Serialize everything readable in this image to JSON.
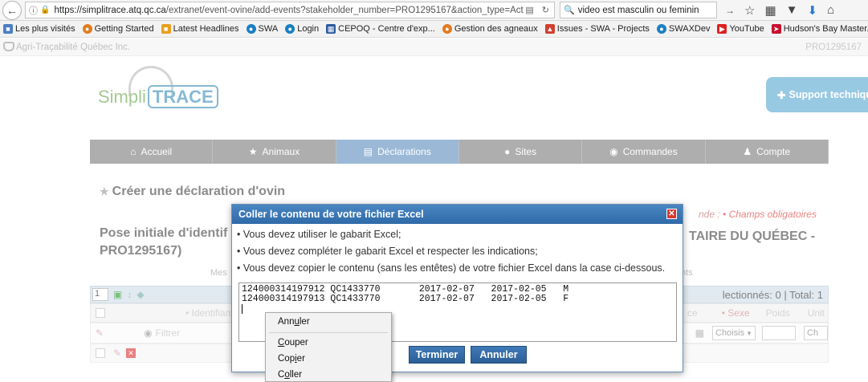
{
  "browser": {
    "url_host": "https://simplitrace.atq.qc.ca",
    "url_path": "/extranet/event-ovine/add-events?stakeholder_number=PRO1295167&action_type=Act",
    "search_text": "video est masculin ou feminin"
  },
  "bookmarks": [
    {
      "label": "Les plus visités",
      "icon": "page-icon",
      "color": "#4a7fc1"
    },
    {
      "label": "Getting Started",
      "icon": "firefox-icon",
      "color": "#e07b20"
    },
    {
      "label": "Latest Headlines",
      "icon": "rss-icon",
      "color": "#e8a020"
    },
    {
      "label": "SWA",
      "icon": "swa-icon",
      "color": "#1a7fc1"
    },
    {
      "label": "Login",
      "icon": "swa-icon",
      "color": "#1a7fc1"
    },
    {
      "label": "CEPOQ - Centre d'exp...",
      "icon": "table-icon",
      "color": "#2c5aa0"
    },
    {
      "label": "Gestion des agneaux",
      "icon": "firefox-icon",
      "color": "#e07b20"
    },
    {
      "label": "Issues - SWA - Projects",
      "icon": "jira-icon",
      "color": "#d04030"
    },
    {
      "label": "SWAXDev",
      "icon": "swa-icon",
      "color": "#1a7fc1"
    },
    {
      "label": "YouTube",
      "icon": "youtube-icon",
      "color": "#e02020"
    },
    {
      "label": "Hudson's Bay Master...",
      "icon": "hudson-icon",
      "color": "#c8102e"
    }
  ],
  "site": {
    "org": "Agri-Traçabilité Québec Inc.",
    "stakeholder": "PRO1295167",
    "brand_simpli": "Simpli",
    "brand_trace": "TRACE",
    "support": "Support technique",
    "menu": [
      "Accueil",
      "Animaux",
      "Déclarations",
      "Sites",
      "Commandes",
      "Compte"
    ],
    "heading": "Créer une déclaration d'ovin",
    "legend_label": "nde :",
    "legend_required": "• Champs obligatoires",
    "pose_title": "Pose initiale d'identif PRO1295167)",
    "right_title": "TAIRE DU QUÉBEC -",
    "faint_left": "Mes",
    "faint_right": "nts",
    "page_num": "1",
    "selection": "lectionnés: 0 | Total: 1",
    "col_identifiants": "• Identifiants",
    "col_sexe": "• Sexe",
    "col_poids": "Poids",
    "col_unit": "Unit",
    "col_ce": "ce",
    "filter_placeholder": "Filtrer",
    "select_choisis": "Choisis",
    "select_ch": "Ch"
  },
  "modal": {
    "title": "Coller le contenu de votre fichier Excel",
    "instructions": [
      "• Vous devez utiliser le gabarit Excel;",
      "• Vous devez compléter le gabarit Excel et respecter les indications;",
      "• Vous devez copier le contenu (sans les entêtes) de votre fichier Excel dans la case ci-dessous."
    ],
    "paste_lines": [
      "124000314197912 QC1433770       2017-02-07   2017-02-05   M",
      "124000314197913 QC1433770       2017-02-07   2017-02-05   F"
    ],
    "btn_terminer": "Terminer",
    "btn_annuler": "Annuler"
  },
  "context_menu": {
    "undo_pre": "Ann",
    "undo_key": "u",
    "undo_post": "ler",
    "cut_key": "C",
    "cut_post": "ouper",
    "copy_pre": "Cop",
    "copy_key": "i",
    "copy_post": "er",
    "paste_pre": "C",
    "paste_key": "o",
    "paste_post": "ller"
  }
}
